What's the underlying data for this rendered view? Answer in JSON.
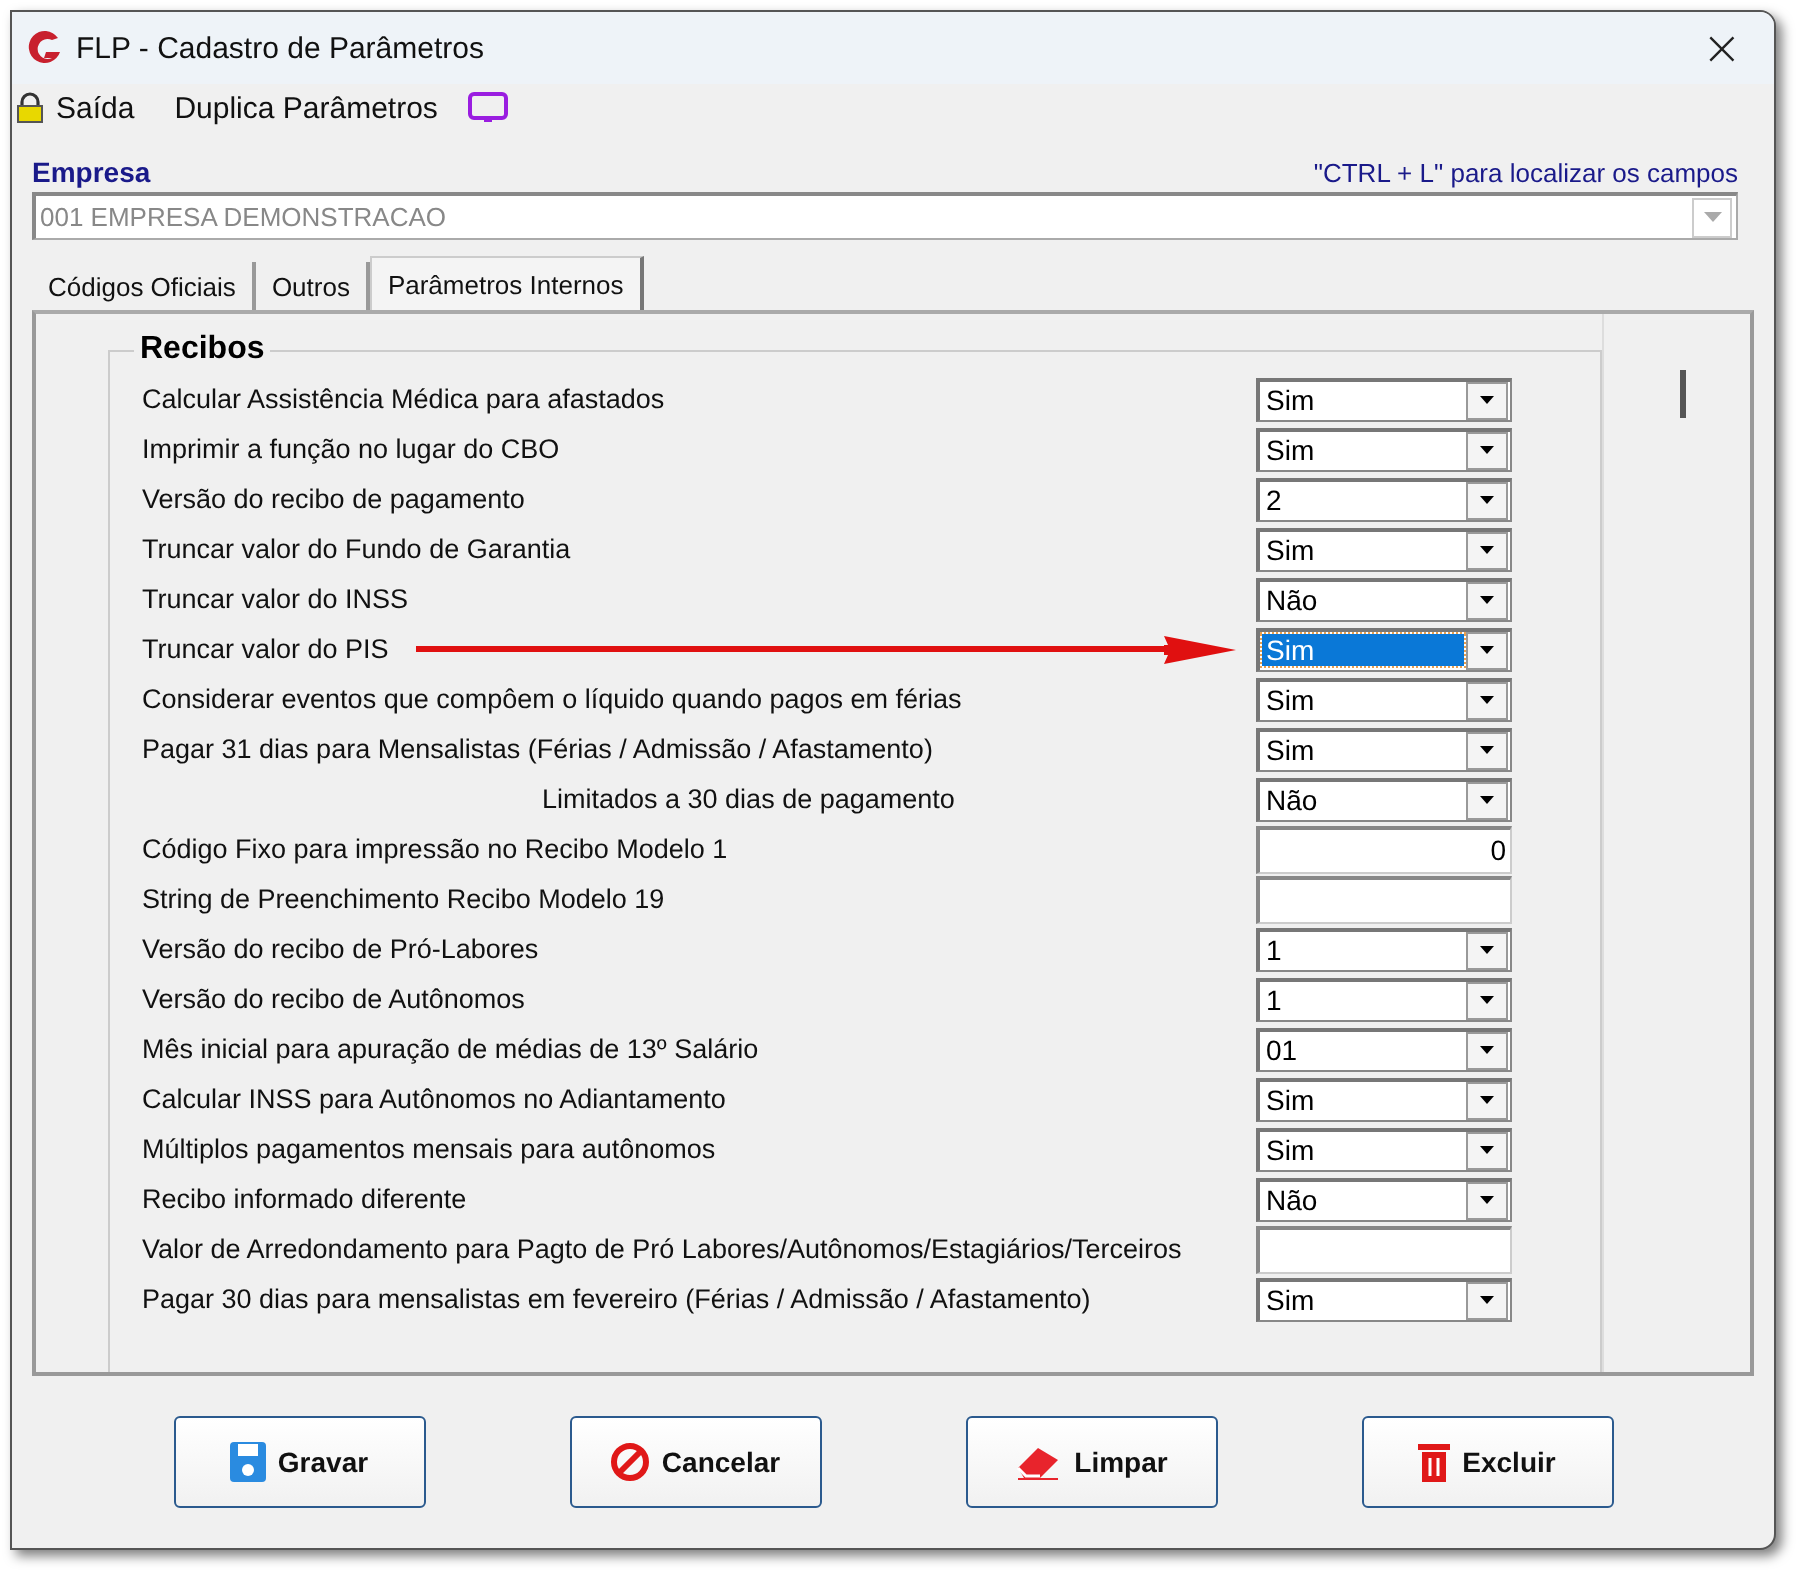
{
  "window": {
    "title": "FLP - Cadastro de Parâmetros",
    "close": "×"
  },
  "toolbar": [
    {
      "label": "Saída",
      "kind": "lock"
    },
    {
      "label": "Duplica Parâmetros",
      "kind": "screen"
    }
  ],
  "empresa": {
    "label": "Empresa",
    "hint": "\"CTRL + L\" para localizar os campos",
    "value": "001 EMPRESA DEMONSTRACAO"
  },
  "tabs": [
    {
      "label": "Códigos Oficiais",
      "selected": false
    },
    {
      "label": "Outros",
      "selected": false
    },
    {
      "label": "Parâmetros Internos",
      "selected": true
    }
  ],
  "group": {
    "title": "Recibos",
    "rows": [
      {
        "label": "Calcular Assistência Médica para afastados",
        "kind": "select",
        "value": "Sim",
        "selected": false,
        "indented": false
      },
      {
        "label": "Imprimir a função no lugar do CBO",
        "kind": "select",
        "value": "Sim",
        "selected": false,
        "indented": false
      },
      {
        "label": "Versão do recibo de pagamento",
        "kind": "select",
        "value": "2",
        "selected": false,
        "indented": false
      },
      {
        "label": "Truncar valor do Fundo de Garantia",
        "kind": "select",
        "value": "Sim",
        "selected": false,
        "indented": false
      },
      {
        "label": "Truncar valor do INSS",
        "kind": "select",
        "value": "Não",
        "selected": false,
        "indented": false
      },
      {
        "label": "Truncar valor do PIS",
        "kind": "select",
        "value": "Sim",
        "selected": true,
        "indented": false
      },
      {
        "label": "Considerar eventos que compôem o líquido quando pagos em férias",
        "kind": "select",
        "value": "Sim",
        "selected": false,
        "indented": false
      },
      {
        "label": "Pagar 31 dias para Mensalistas (Férias / Admissão / Afastamento)",
        "kind": "select",
        "value": "Sim",
        "selected": false,
        "indented": false
      },
      {
        "label": "Limitados a 30 dias de pagamento",
        "kind": "select",
        "value": "Não",
        "selected": false,
        "indented": true
      },
      {
        "label": "Código Fixo para impressão no Recibo Modelo 1",
        "kind": "input",
        "value": "0",
        "selected": false,
        "indented": false
      },
      {
        "label": "String de Preenchimento Recibo Modelo 19",
        "kind": "input",
        "selected": false,
        "indented": false
      },
      {
        "label": "Versão do recibo de Pró-Labores",
        "kind": "select",
        "value": "1",
        "selected": false,
        "indented": false
      },
      {
        "label": "Versão do recibo de Autônomos",
        "kind": "select",
        "value": "1",
        "selected": false,
        "indented": false
      },
      {
        "label": "Mês inicial para apuração de médias de 13º Salário",
        "kind": "select",
        "value": "01",
        "selected": false,
        "indented": false
      },
      {
        "label": "Calcular INSS para Autônomos no Adiantamento",
        "kind": "select",
        "value": "Sim",
        "selected": false,
        "indented": false
      },
      {
        "label": "Múltiplos pagamentos mensais para autônomos",
        "kind": "select",
        "value": "Sim",
        "selected": false,
        "indented": false
      },
      {
        "label": "Recibo informado diferente",
        "kind": "select",
        "value": "Não",
        "selected": false,
        "indented": false
      },
      {
        "label": "Valor de Arredondamento para Pagto de Pró Labores/Autônomos/Estagiários/Terceiros",
        "kind": "input",
        "selected": false,
        "indented": false
      },
      {
        "label": "Pagar 30 dias para mensalistas em fevereiro (Férias / Admissão / Afastamento)",
        "kind": "select",
        "value": "Sim",
        "selected": false,
        "indented": false
      }
    ]
  },
  "buttons": [
    {
      "label": "Gravar",
      "kind": "save"
    },
    {
      "label": "Cancelar",
      "kind": "cancel"
    },
    {
      "label": "Limpar",
      "kind": "clear"
    },
    {
      "label": "Excluir",
      "kind": "delete"
    }
  ]
}
